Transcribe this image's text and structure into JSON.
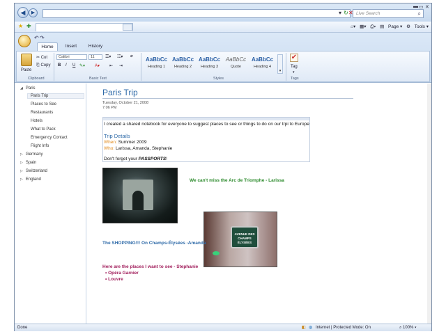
{
  "browser": {
    "search_placeholder": "Live Search",
    "tools": {
      "page": "Page",
      "tools": "Tools"
    }
  },
  "ribbon": {
    "tabs": [
      "Home",
      "Insert",
      "History"
    ],
    "clipboard": {
      "paste": "Paste",
      "cut": "Cut",
      "copy": "Copy",
      "group": "Clipboard"
    },
    "basic_text": {
      "font": "Calibri",
      "size": "11",
      "group": "Basic Text"
    },
    "styles": {
      "sample": "AaBbCc",
      "items": [
        "Heading 1",
        "Heading 2",
        "Heading 3",
        "Quote",
        "Heading 4"
      ],
      "group": "Styles"
    },
    "tags": {
      "tag": "Tag",
      "group": "Tags"
    }
  },
  "nav": {
    "items": [
      {
        "label": "Paris",
        "level": 0,
        "arrow": "◢"
      },
      {
        "label": "Paris Trip",
        "level": 1
      },
      {
        "label": "Places to See",
        "level": 1
      },
      {
        "label": "Restaurants",
        "level": 1
      },
      {
        "label": "Hotels",
        "level": 1
      },
      {
        "label": "What to Pack",
        "level": 1
      },
      {
        "label": "Emergency Contact",
        "level": 1
      },
      {
        "label": "Flight Info",
        "level": 1
      },
      {
        "label": "Germany",
        "level": 0,
        "arrow": "▷"
      },
      {
        "label": "Spain",
        "level": 0,
        "arrow": "▷"
      },
      {
        "label": "Switzerland",
        "level": 0,
        "arrow": "▷"
      },
      {
        "label": "England",
        "level": 0,
        "arrow": "▷"
      }
    ]
  },
  "page": {
    "title": "Paris Trip",
    "date": "Tuesday, October 21, 2008",
    "time": "7:06 PM",
    "intro": "I created a shared notebook for everyone to suggest places to see or things to do on our trpi to Europe",
    "details_heading": "Trip Details",
    "when_label": "When:",
    "when_value": "Summer 2009",
    "who_label": "Who:",
    "who_value": "Larissa, Amanda, Stephanie",
    "reminder_prefix": "Don't forget your ",
    "reminder_emphasis": "PASSPORTS",
    "reminder_suffix": "!",
    "caption_arc": "We can't miss the Arc de Triomphe - Larissa",
    "caption_shopping": "The SHOPPING!!! On Champs-Élysées -Amanda",
    "sign_text": "AVENUE DES CHAMPS ÉLYSÉES",
    "places_heading": "Here are the places I want to see - Stephanie",
    "places": [
      "Opéra Garnier",
      "Louvre"
    ]
  },
  "status": {
    "left": "Done",
    "zone": "Internet | Protected Mode: On",
    "zoom": "100%"
  },
  "colors": {
    "title_blue": "#2e6aa8",
    "label_orange": "#e08a1a",
    "caption_green": "#2b8a2b",
    "caption_blue": "#2e6aa8",
    "caption_magenta": "#a01c5a"
  }
}
